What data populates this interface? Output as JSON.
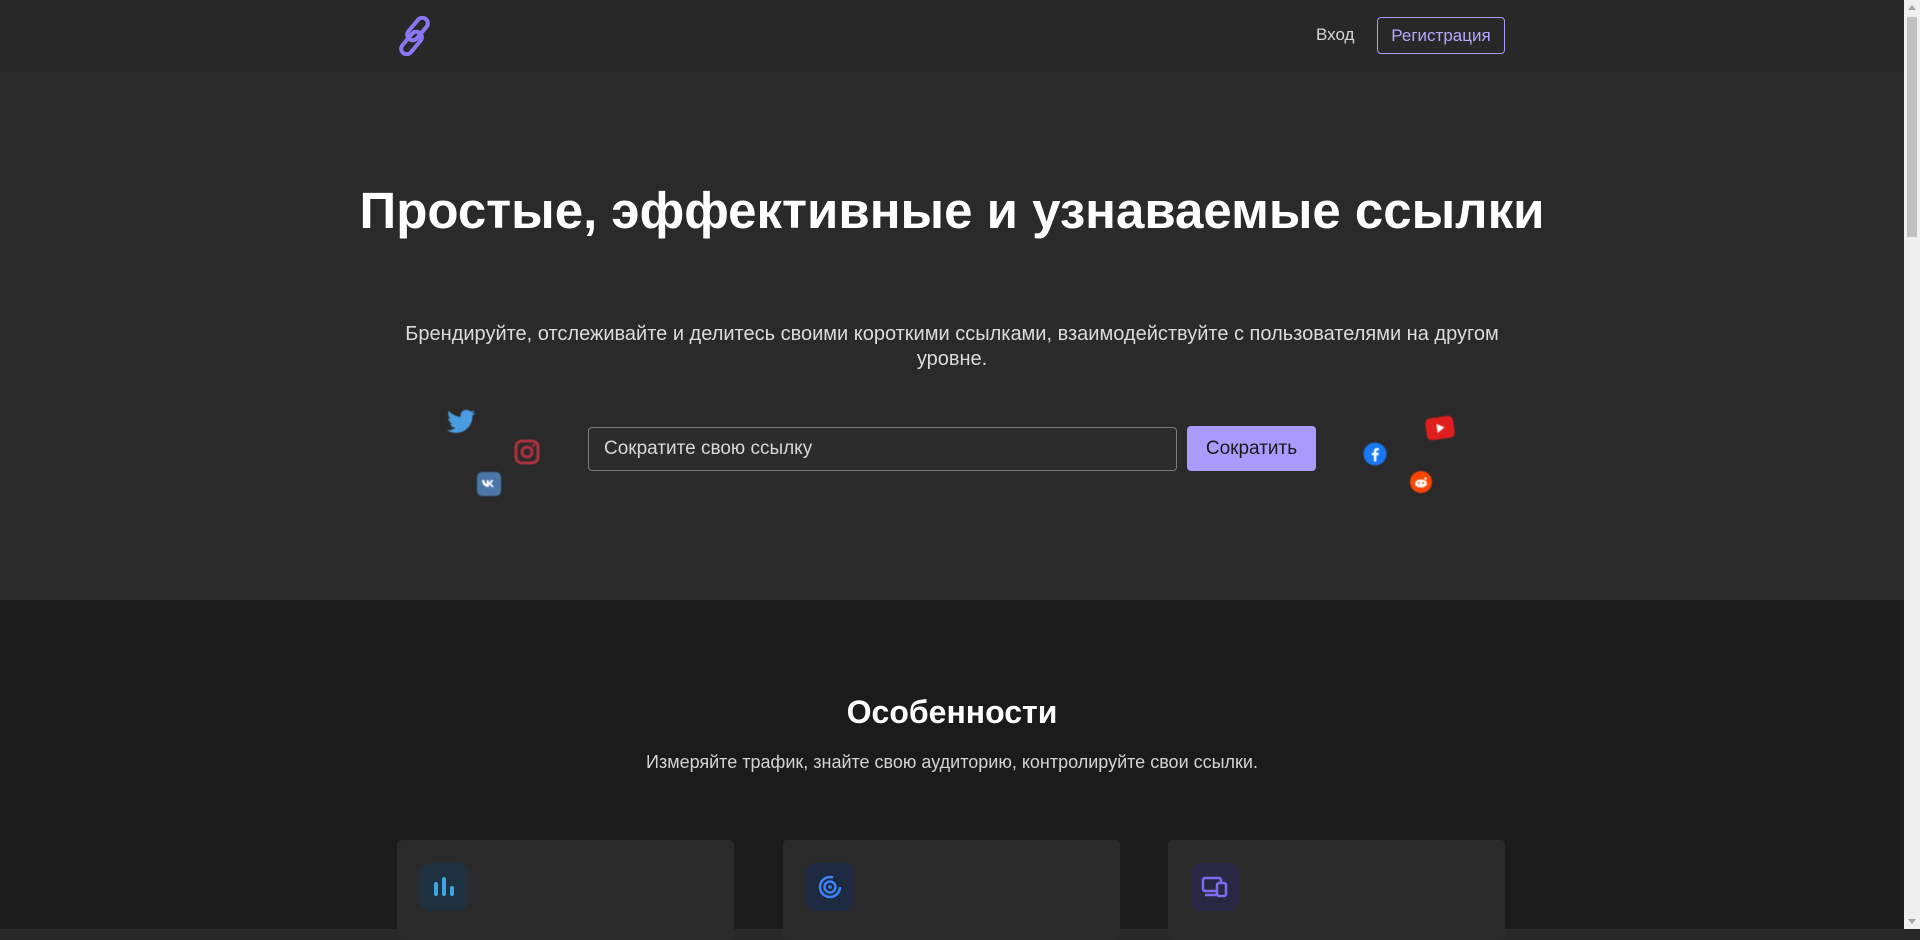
{
  "header": {
    "logo_icon": "link-icon",
    "login_label": "Вход",
    "register_label": "Регистрация"
  },
  "hero": {
    "title": "Простые, эффективные и узнаваемые ссылки",
    "subtitle": "Брендируйте, отслеживайте и делитесь своими короткими ссылками, взаимодействуйте с пользователями на другом уровне.",
    "input_placeholder": "Сократите свою ссылку",
    "input_value": "",
    "shorten_label": "Сократить",
    "social_icons": [
      "twitter-icon",
      "instagram-icon",
      "vk-icon",
      "facebook-icon",
      "youtube-icon",
      "reddit-icon"
    ]
  },
  "features": {
    "title": "Особенности",
    "subtitle": "Измеряйте трафик, знайте свою аудиторию, контролируйте свои ссылки.",
    "cards": [
      {
        "icon": "bar-chart-icon"
      },
      {
        "icon": "radar-icon"
      },
      {
        "icon": "devices-icon"
      }
    ]
  },
  "colors": {
    "accent": "#a99afc",
    "hero_background": "#2a2a2a",
    "features_background": "#1b1b1b",
    "card_background": "#2a2a2a"
  }
}
